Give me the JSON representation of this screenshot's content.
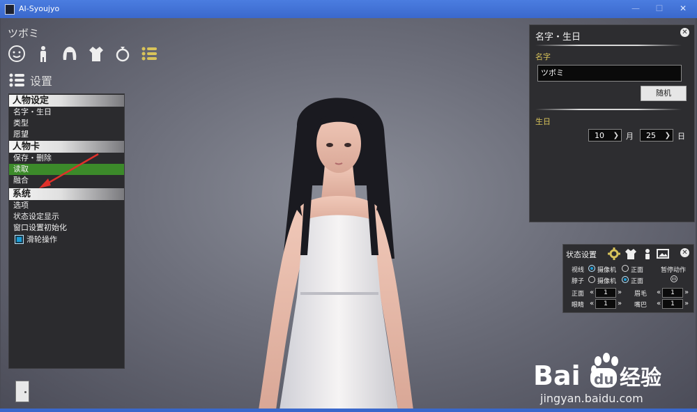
{
  "window": {
    "title": "AI-Syoujyo",
    "min_label": "—",
    "max_label": "☐",
    "close_label": "✕"
  },
  "character": {
    "name": "ツボミ"
  },
  "categories": [
    "face-icon",
    "body-icon",
    "hair-icon",
    "clothes-icon",
    "accessory-icon",
    "settings-list-icon"
  ],
  "section": {
    "title": "设置"
  },
  "left_menu": {
    "group1": "人物设定",
    "g1_items": [
      "名字・生日",
      "类型",
      "愿望"
    ],
    "group2": "人物卡",
    "g2_items": [
      "保存・删除",
      "读取",
      "融合"
    ],
    "selected": "读取",
    "group3": "系统",
    "g3_items": [
      "选项",
      "状态设定显示",
      "窗口设置初始化"
    ],
    "toggle_label": "滑轮操作"
  },
  "name_panel": {
    "title": "名字・生日",
    "name_label": "名字",
    "name_value": "ツボミ",
    "random_button": "随机",
    "birthday_label": "生日",
    "month_value": "10",
    "month_unit": "月",
    "day_value": "25",
    "day_unit": "日"
  },
  "status_panel": {
    "title": "状态设置",
    "gaze_label": "视线",
    "neck_label": "脖子",
    "camera": "摄像机",
    "front": "正面",
    "gaze_selected": "摄像机",
    "neck_selected": "正面",
    "pause_label": "暂停动作",
    "front_label": "正面",
    "front_value": "1",
    "eyebrow_label": "眉毛",
    "eyebrow_value": "1",
    "eyes_label": "眼睛",
    "eyes_value": "1",
    "mouth_label": "嘴巴",
    "mouth_value": "1"
  },
  "watermark": {
    "text": "Bai du 经验",
    "url": "jingyan.baidu.com"
  },
  "colors": {
    "accent_yellow": "#d8c35a",
    "selected_green": "#3c8a2a",
    "radio_blue": "#1a9bd6",
    "titlebar": "#3f6fd6"
  }
}
